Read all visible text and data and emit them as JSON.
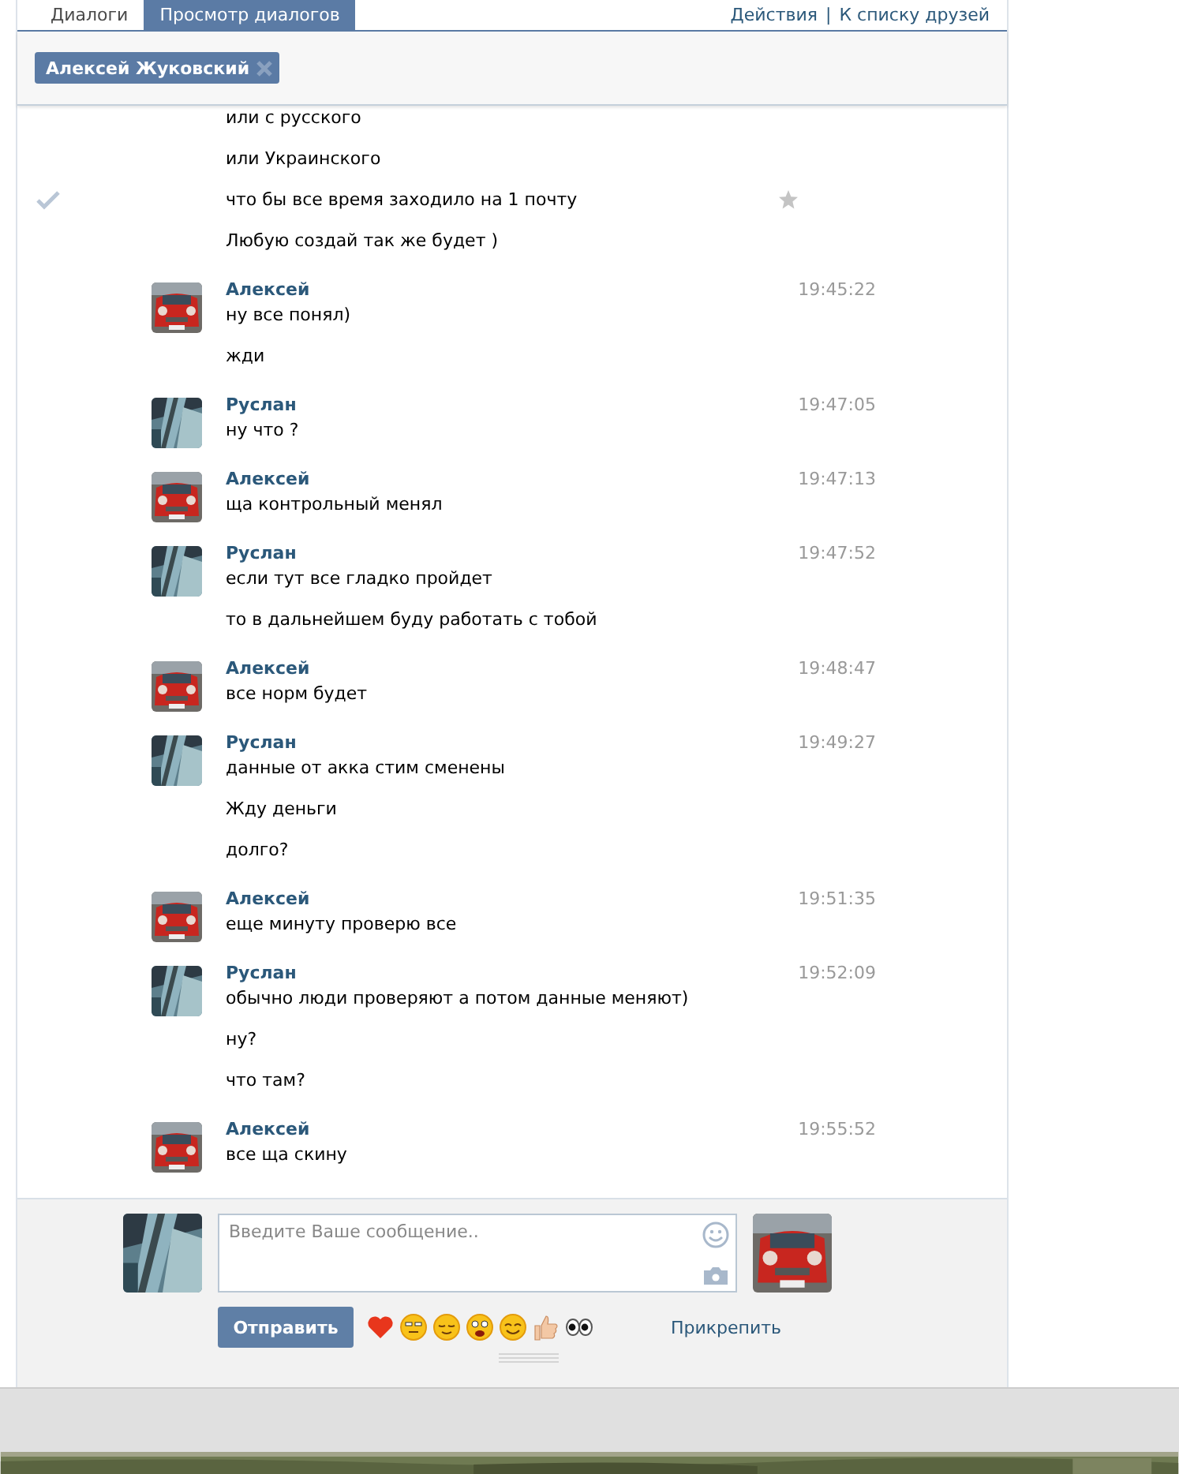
{
  "tabs": [
    {
      "label": "Диалоги",
      "selected": false
    },
    {
      "label": "Просмотр диалогов",
      "selected": true
    }
  ],
  "links": [
    "Действия",
    "К списку друзей"
  ],
  "link_separator": "|",
  "recipient": {
    "name": "Алексей Жуковский"
  },
  "messages": [
    {
      "kind": "continued",
      "lines": [
        {
          "text": "или с русского",
          "hovered": false
        },
        {
          "text": "или Украинского",
          "hovered": false
        },
        {
          "text": "что бы все время заходило на 1 почту",
          "hovered": true
        },
        {
          "text": "Любую создай так же будет )",
          "hovered": false
        }
      ]
    },
    {
      "kind": "peer",
      "author": "Алексей",
      "time": "19:45:22",
      "lines": [
        {
          "text": "ну все понял)",
          "hovered": false
        },
        {
          "text": "жди",
          "hovered": false
        }
      ]
    },
    {
      "kind": "self",
      "author": "Руслан",
      "time": "19:47:05",
      "lines": [
        {
          "text": "ну что ?",
          "hovered": false
        }
      ]
    },
    {
      "kind": "peer",
      "author": "Алексей",
      "time": "19:47:13",
      "lines": [
        {
          "text": "ща контрольный менял",
          "hovered": false
        }
      ]
    },
    {
      "kind": "self",
      "author": "Руслан",
      "time": "19:47:52",
      "lines": [
        {
          "text": "если тут все гладко пройдет",
          "hovered": false
        },
        {
          "text": "то в дальнейшем буду работать с тобой",
          "hovered": false
        }
      ]
    },
    {
      "kind": "peer",
      "author": "Алексей",
      "time": "19:48:47",
      "lines": [
        {
          "text": "все норм будет",
          "hovered": false
        }
      ]
    },
    {
      "kind": "self",
      "author": "Руслан",
      "time": "19:49:27",
      "lines": [
        {
          "text": "данные от акка стим сменены",
          "hovered": false
        },
        {
          "text": "Жду деньги",
          "hovered": false
        },
        {
          "text": "долго?",
          "hovered": false
        }
      ]
    },
    {
      "kind": "peer",
      "author": "Алексей",
      "time": "19:51:35",
      "lines": [
        {
          "text": "еще минуту проверю все",
          "hovered": false
        }
      ]
    },
    {
      "kind": "self",
      "author": "Руслан",
      "time": "19:52:09",
      "lines": [
        {
          "text": "обычно люди проверяют а потом данные меняют)",
          "hovered": false
        },
        {
          "text": "ну?",
          "hovered": false
        },
        {
          "text": "что там?",
          "hovered": false
        }
      ]
    },
    {
      "kind": "peer",
      "author": "Алексей",
      "time": "19:55:52",
      "lines": [
        {
          "text": "все ща скину",
          "hovered": false
        }
      ]
    }
  ],
  "composer": {
    "placeholder": "Введите Ваше сообщение..",
    "send": "Отправить",
    "attach": "Прикрепить",
    "emojis": [
      {
        "kind": "heart"
      },
      {
        "kind": "meh"
      },
      {
        "kind": "relieved"
      },
      {
        "kind": "scared"
      },
      {
        "kind": "smile"
      },
      {
        "kind": "thumbs-up"
      },
      {
        "kind": "eyes"
      }
    ]
  }
}
